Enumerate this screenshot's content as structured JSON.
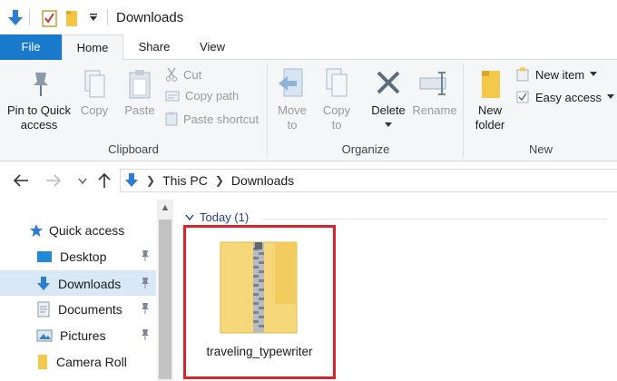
{
  "window": {
    "title": "Downloads"
  },
  "ribbon_tabs": {
    "file": "File",
    "home": "Home",
    "share": "Share",
    "view": "View"
  },
  "clipboard": {
    "pin_line1": "Pin to Quick",
    "pin_line2": "access",
    "copy": "Copy",
    "paste": "Paste",
    "cut": "Cut",
    "copy_path": "Copy path",
    "paste_shortcut": "Paste shortcut",
    "label": "Clipboard"
  },
  "organize": {
    "move_to_line1": "Move",
    "move_to_line2": "to",
    "copy_to_line1": "Copy",
    "copy_to_line2": "to",
    "delete": "Delete",
    "rename": "Rename",
    "label": "Organize"
  },
  "new_group": {
    "new_folder_line1": "New",
    "new_folder_line2": "folder",
    "new_item": "New item",
    "easy_access": "Easy access",
    "label": "New"
  },
  "address": {
    "crumbs": [
      "This PC",
      "Downloads"
    ]
  },
  "navpane": {
    "items": [
      {
        "label": "Quick access",
        "icon": "star-icon"
      },
      {
        "label": "Desktop",
        "icon": "desktop-folder-icon"
      },
      {
        "label": "Downloads",
        "icon": "downloads-folder-icon"
      },
      {
        "label": "Documents",
        "icon": "documents-folder-icon"
      },
      {
        "label": "Pictures",
        "icon": "pictures-folder-icon"
      },
      {
        "label": "Camera Roll",
        "icon": "folder-icon"
      }
    ]
  },
  "content": {
    "group_header": "Today (1)",
    "file_name": "traveling_typewriter"
  },
  "colors": {
    "accent": "#1979ca",
    "highlight_border": "#d8232a",
    "selected_bg": "#d9e8f7"
  }
}
